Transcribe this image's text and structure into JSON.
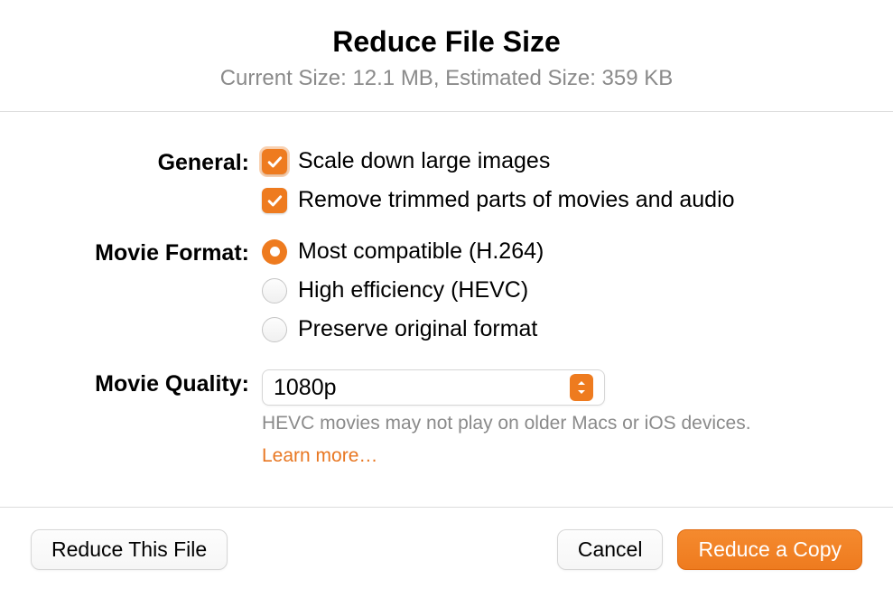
{
  "header": {
    "title": "Reduce File Size",
    "subtitle": "Current Size: 12.1 MB, Estimated Size: 359 KB"
  },
  "general": {
    "label": "General:",
    "options": {
      "scale_down": "Scale down large images",
      "remove_trimmed": "Remove trimmed parts of movies and audio"
    }
  },
  "movie_format": {
    "label": "Movie Format:",
    "options": {
      "h264": "Most compatible (H.264)",
      "hevc": "High efficiency (HEVC)",
      "preserve": "Preserve original format"
    }
  },
  "movie_quality": {
    "label": "Movie Quality:",
    "value": "1080p",
    "note": "HEVC movies may not play on older Macs or iOS devices.",
    "learn_more": "Learn more…"
  },
  "footer": {
    "reduce_this": "Reduce This File",
    "cancel": "Cancel",
    "reduce_copy": "Reduce a Copy"
  }
}
